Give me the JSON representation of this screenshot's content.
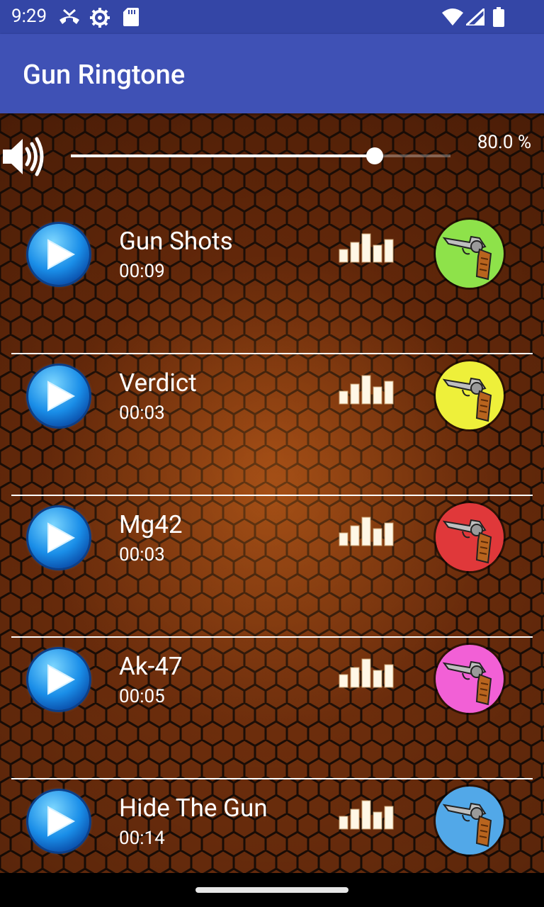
{
  "status_bar": {
    "time": "9:29",
    "left_icons": [
      "missed-call-icon",
      "settings-icon",
      "sd-card-icon"
    ],
    "right_icons": [
      "wifi-icon",
      "signal-icon",
      "battery-icon"
    ]
  },
  "app_bar": {
    "title": "Gun Ringtone",
    "color": "#3f51b5"
  },
  "volume": {
    "percent_label": "80.0 %",
    "level": 0.8
  },
  "songs": [
    {
      "name": "Gun Shots",
      "duration": "00:09",
      "gun_color": "#8ee24a"
    },
    {
      "name": "Verdict",
      "duration": "00:03",
      "gun_color": "#eef03a"
    },
    {
      "name": "Mg42",
      "duration": "00:03",
      "gun_color": "#e0383a"
    },
    {
      "name": "Ak-47",
      "duration": "00:05",
      "gun_color": "#f260d6"
    },
    {
      "name": "Hide The Gun",
      "duration": "00:14",
      "gun_color": "#52a8e8"
    }
  ]
}
